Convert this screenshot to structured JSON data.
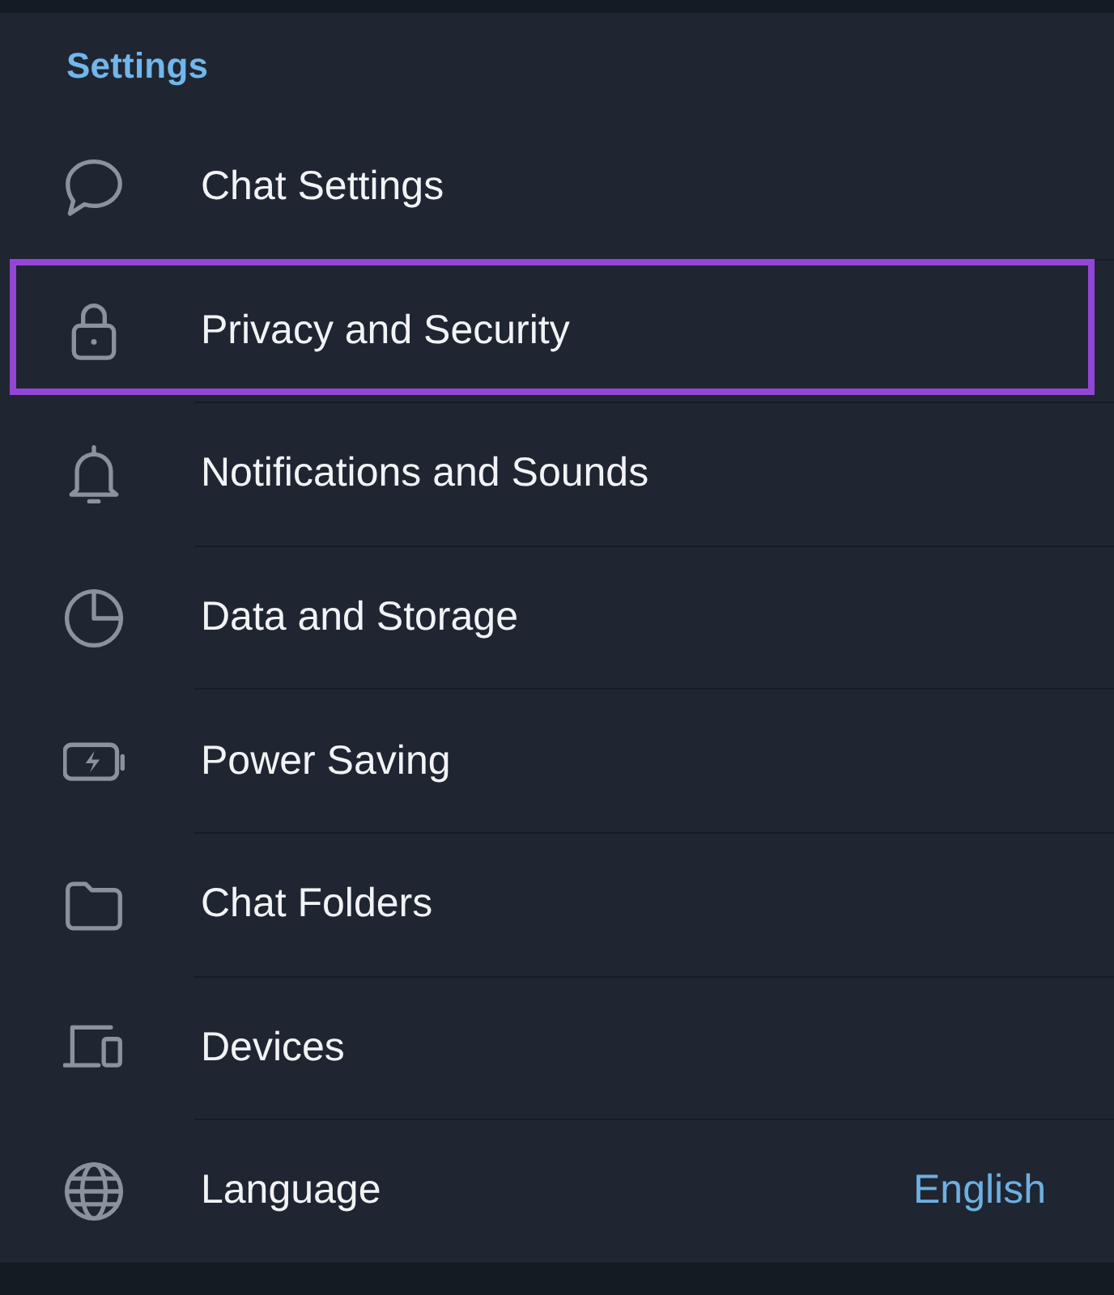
{
  "header": {
    "title": "Settings"
  },
  "items": [
    {
      "label": "Chat Settings",
      "highlighted": false
    },
    {
      "label": "Privacy and Security",
      "highlighted": true
    },
    {
      "label": "Notifications and Sounds",
      "highlighted": false
    },
    {
      "label": "Data and Storage",
      "highlighted": false
    },
    {
      "label": "Power Saving",
      "highlighted": false
    },
    {
      "label": "Chat Folders",
      "highlighted": false
    },
    {
      "label": "Devices",
      "highlighted": false
    },
    {
      "label": "Language",
      "highlighted": false,
      "value": "English"
    }
  ]
}
